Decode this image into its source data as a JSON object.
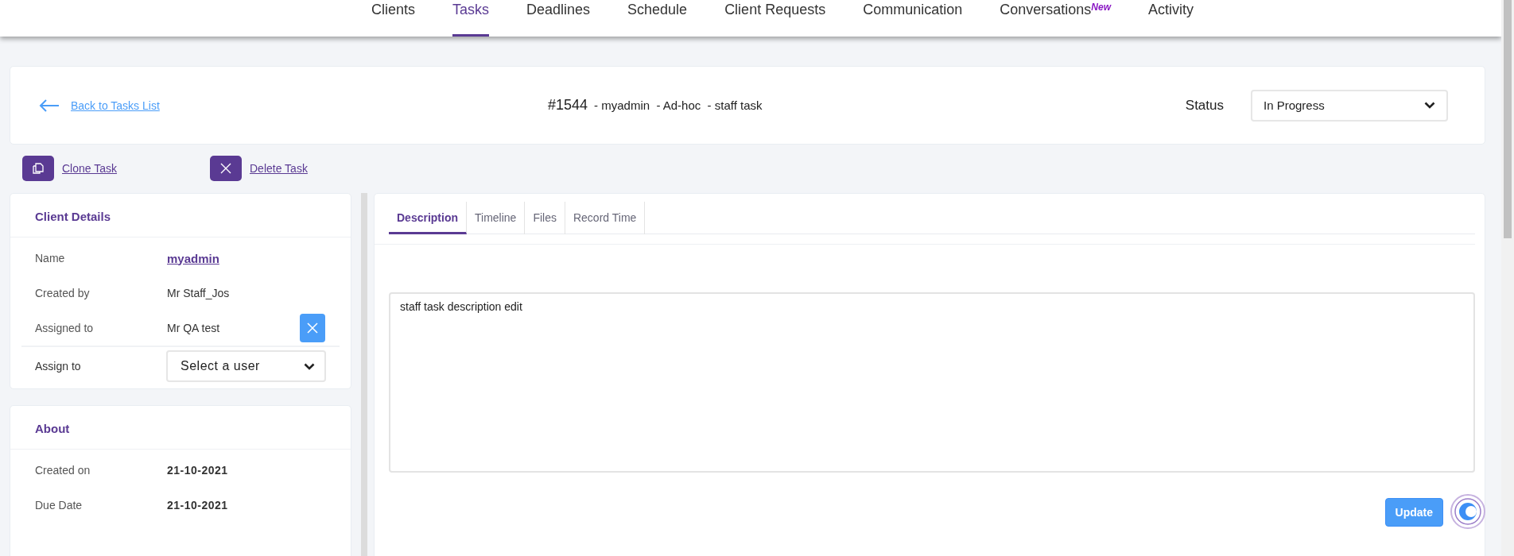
{
  "nav": {
    "items": [
      {
        "label": "Clients",
        "selected": false
      },
      {
        "label": "Tasks",
        "selected": true
      },
      {
        "label": "Deadlines",
        "selected": false
      },
      {
        "label": "Schedule",
        "selected": false
      },
      {
        "label": "Client Requests",
        "selected": false
      },
      {
        "label": "Communication",
        "selected": false
      },
      {
        "label": "Conversations",
        "selected": false,
        "badge": "New"
      },
      {
        "label": "Activity",
        "selected": false
      }
    ]
  },
  "header": {
    "back_link": "Back to Tasks List",
    "task_number": "#1544",
    "task_meta": "- myadmin  - Ad-hoc  - staff task",
    "status_label": "Status",
    "status_value": "In Progress"
  },
  "actions": [
    {
      "kind": "clone",
      "label": "Clone Task"
    },
    {
      "kind": "delete",
      "label": "Delete Task"
    }
  ],
  "client_details": {
    "title": "Client Details",
    "rows": [
      {
        "label": "Name",
        "value": "myadmin",
        "kind": "link"
      },
      {
        "label": "Created by",
        "value": "Mr Staff_Jos",
        "kind": "text"
      },
      {
        "label": "Assigned to",
        "value": "Mr QA test",
        "kind": "removable"
      }
    ],
    "assign": {
      "label": "Assign to",
      "placeholder": "Select a user"
    }
  },
  "about": {
    "title": "About",
    "rows": [
      {
        "label": "Created on",
        "value": "21-10-2021"
      },
      {
        "label": "Due Date",
        "value": "21-10-2021"
      }
    ]
  },
  "tabs": [
    {
      "label": "Description",
      "selected": true
    },
    {
      "label": "Timeline",
      "selected": false
    },
    {
      "label": "Files",
      "selected": false
    },
    {
      "label": "Record Time",
      "selected": false
    }
  ],
  "description": {
    "value": "staff task description edit",
    "button": "Update"
  }
}
